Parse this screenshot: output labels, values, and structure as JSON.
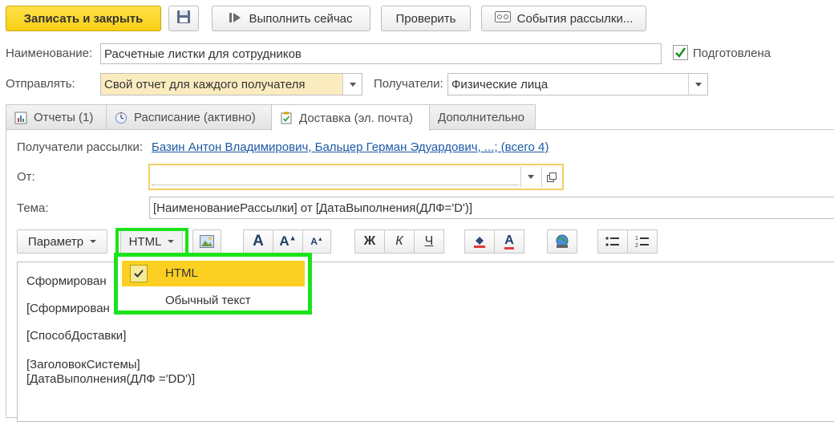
{
  "toolbar": {
    "save_close_label": "Записать и закрыть",
    "run_now_label": "Выполнить сейчас",
    "check_label": "Проверить",
    "events_label": "События рассылки..."
  },
  "form": {
    "name_label": "Наименование:",
    "name_value": "Расчетные листки для сотрудников",
    "prepared_label": "Подготовлена",
    "prepared_checked": true,
    "send_label": "Отправлять:",
    "send_value": "Свой отчет для каждого получателя",
    "recipients_label": "Получатели:",
    "recipients_value": "Физические лица"
  },
  "tabs": [
    {
      "label": "Отчеты (1)",
      "icon": "report-icon",
      "active": false
    },
    {
      "label": "Расписание (активно)",
      "icon": "schedule-icon",
      "active": false
    },
    {
      "label": "Доставка (эл. почта)",
      "icon": "clipboard-icon",
      "active": true
    },
    {
      "label": "Дополнительно",
      "icon": "",
      "active": false
    }
  ],
  "delivery": {
    "mailing_recipients_label": "Получатели рассылки:",
    "mailing_recipients_link": "Базин Антон Владимирович, Бальцер Герман Эдуардович, ...; (всего 4)",
    "from_label": "От:",
    "from_value": "",
    "subject_label": "Тема:",
    "subject_value": "[НаименованиеРассылки] от [ДатаВыполнения(ДЛФ='D')]"
  },
  "format_toolbar": {
    "parameter_label": "Параметр",
    "format_label": "HTML",
    "bold_glyph": "Ж",
    "italic_glyph": "К",
    "underline_glyph": "Ч"
  },
  "format_menu": {
    "items": [
      {
        "label": "HTML",
        "selected": true
      },
      {
        "label": "Обычный текст",
        "selected": false
      }
    ]
  },
  "editor": {
    "lines": [
      "Сформирован",
      "[Сформирован",
      "[СпособДоставки]",
      "[ЗаголовокСистемы]",
      "[ДатаВыполнения(ДЛФ ='DD')]"
    ]
  },
  "colors": {
    "accent_yellow": "#f9cf15",
    "highlight_green": "#1be31b",
    "link_blue": "#1c5aa6",
    "menu_selected": "#fbd022"
  }
}
